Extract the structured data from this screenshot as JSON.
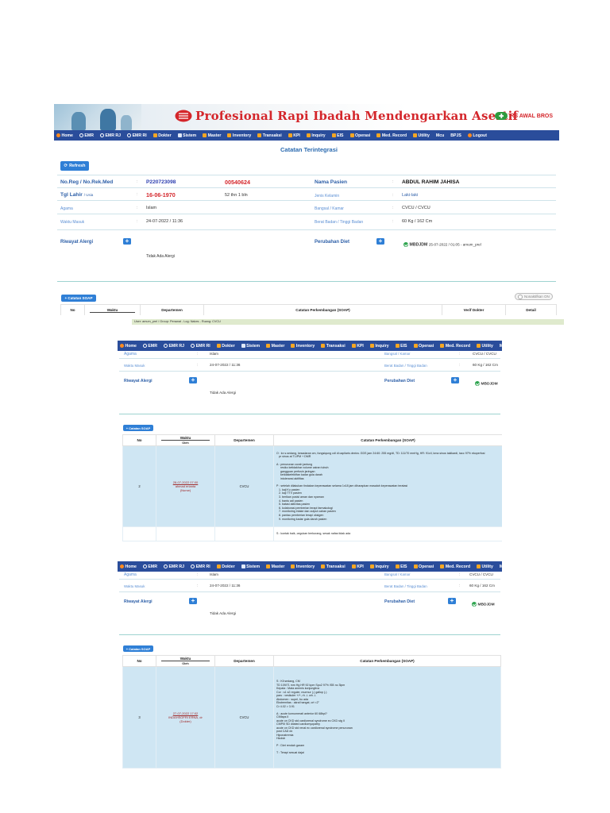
{
  "banner": {
    "tagline": "Profesional Rapi Ibadah Mendengarkan Asertif",
    "logo_text": "RS AWAL BROS"
  },
  "nav": [
    {
      "label": "Home",
      "icon": "home-icon"
    },
    {
      "label": "EMR",
      "icon": "record-icon"
    },
    {
      "label": "EMR RJ",
      "icon": "record-icon"
    },
    {
      "label": "EMR RI",
      "icon": "record-icon"
    },
    {
      "label": "Dokter",
      "icon": "doctor-icon"
    },
    {
      "label": "Sistem",
      "icon": "gear-icon"
    },
    {
      "label": "Master",
      "icon": "database-icon"
    },
    {
      "label": "Inventory",
      "icon": "box-icon"
    },
    {
      "label": "Transaksi",
      "icon": "cart-icon"
    },
    {
      "label": "KPI",
      "icon": "chart-icon"
    },
    {
      "label": "Inquiry",
      "icon": "search-icon"
    },
    {
      "label": "EIS",
      "icon": "dashboard-icon"
    },
    {
      "label": "Operasi",
      "icon": "plus-icon"
    },
    {
      "label": "Med. Record",
      "icon": "folder-icon"
    },
    {
      "label": "Utility",
      "icon": "wrench-icon"
    },
    {
      "label": "Mcu",
      "icon": ""
    },
    {
      "label": "BPJS",
      "icon": ""
    },
    {
      "label": "Logout",
      "icon": "power-icon"
    }
  ],
  "page": {
    "title": "Catatan Terintegrasi",
    "refresh_label": "Refresh",
    "add_soap_label": "+ Catatan SOAP",
    "toggle_label": "Nonaktifkan ON"
  },
  "patient": {
    "no_reg_label": "No.Reg / No.Rek.Med",
    "no_reg": "P220723098",
    "no_rm": "00540624",
    "nama_label": "Nama Pasien",
    "nama": "ABDUL RAHIM JAHISA",
    "tgl_lahir_label": "Tgl Lahir",
    "tgl_lahir_suffix": "/ Usia",
    "tgl_lahir": "16-06-1970",
    "usia": "52 thn 1 bln",
    "jk_label": "Jenis Kelamin",
    "jk": "Laki-laki",
    "agama_label": "Agama",
    "agama": "Islam",
    "bangsal_label": "Bangsal / Kamar",
    "bangsal": "CVCU / CVCU",
    "waktu_masuk_label": "Waktu Masuk",
    "waktu_masuk": "24-07-2022 / 11:36",
    "bb_label": "Berat Badan / Tinggi Badan",
    "bb": "60 Kg / 162 Cm",
    "alergi_label": "Riwayat Alergi",
    "alergi": "Tidak Ada Alergi",
    "diet_label": "Perubahan Diet",
    "diet_code": "MBDJDM",
    "diet_meta": "25-07-2022 / 01:05 - amum_prel",
    "diet_code_short": "MBDJDM"
  },
  "table": {
    "headers": [
      "No",
      "Waktu",
      "Departemen",
      "Catatan Perkembangan (SOAP)",
      "Verif Dokter",
      "Detail"
    ],
    "waktu_sub": "Oleh"
  },
  "status_bar": "User: amum_prel / Group: Perawat - Log: Nakes - Ruang: CVCU",
  "rows": [
    {
      "no": "2",
      "waktu": "28-07-2022 07:00",
      "oleh": "ahmad erianta",
      "role": "(Nurse)",
      "dept": "CVCU",
      "soap": "O : kx s.sedang, kesadaran cm, fungsiqung cdl di capilaris dextra. GDS jam 24:60: 255 mg/dl, TD: 111/70 mmHg, HR: 91x/i, kma sinus takikardi, tacc 97% ekoperfusi\n   pr sinus at TLIPM + DMR\n\nA : penurunan curah jantung\n     resiko ketidakhar volume cairan tubuh\n     gangguan perfusin jaringan\n     ketidakefektifan kadar gula darah\n     intoleransi aktifitas\n\nP : setelah dilakukan tindakan keperawatan selama 1x18 jam diharapkan masalah keperawatan teratasi\n   1. kaji Ku pasien\n   2. kaji TTV pasien\n   3. berikan posisi aman dan nyaman\n   4. bantu adl pasien\n   5. batasi aktivitas pasien\n   6. kolaborasi pemberian terapi farmakologi\n   7. monitoring intake dan output cairan pasien\n   8. pantau pemberian terapi oksigen\n   9. monitoring kadar gula darah pasien",
      "soap_tail": "S : kontak baik, cegukan berkurang, sesak nafas tidak ada"
    },
    {
      "no": "3",
      "waktu": "27-07-2022 17:02",
      "oleh": "INDAHSOFRI ERNA, dr",
      "role": "(Dokter)",
      "dept": "CVCU",
      "soap": "S : Kll sedang, CM\nTD 109/71 mm Hg HR 92 kpm Spo2 97% ISB nc 3lpm\nKepala : Mata anemis konjungtiva\nCor : s1 s2 reguler, murmur (-) gallop (-)\nparu : vesikuler +/+, rh -/- wh -/-\nAbdomen : supel, bu ada\nEkstremitas : akral hangat, crt <2\"\nCr 4.02 > 3.91\n\nA : acute kornumerati anterior 60 68bpl?\nCMfaps II\nacute on CKD std cardiorenal syndrome ec CKD stg II\nCMPIII SD dilated cardiomyopathy\nacute on CKD std renal ec cardiorenal syndrome penurunan\npost CAD dx\nHiponatremia\nHicdsb\n\nP : Diet rendah garam\n\nT : Terapi sesuai dajai"
    }
  ]
}
